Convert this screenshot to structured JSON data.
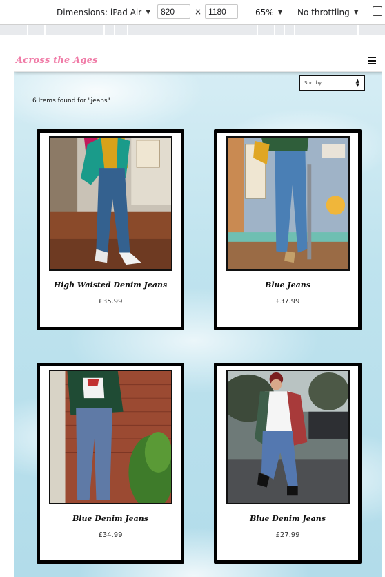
{
  "devtools": {
    "dimensions_label": "Dimensions: iPad Air",
    "width": "820",
    "times": "×",
    "height": "1180",
    "zoom": "65%",
    "throttling": "No throttling"
  },
  "site": {
    "brand": "Across the Ages",
    "sort_placeholder": "Sort by...",
    "result_count": "6 Items found for \"jeans\""
  },
  "products": [
    {
      "name": "High Waisted Denim Jeans",
      "price": "£35.99"
    },
    {
      "name": "Blue Jeans",
      "price": "£37.99"
    },
    {
      "name": "Blue Denim Jeans",
      "price": "£34.99"
    },
    {
      "name": "Blue Denim Jeans",
      "price": "£27.99"
    }
  ],
  "icons": {
    "dropdown": "caret-down-icon",
    "menu": "hamburger-menu-icon",
    "sort_arrows": "sort-arrows-icon",
    "rotate": "rotate-device-icon"
  },
  "colors": {
    "brand": "#f07aa6",
    "card_border": "#000000",
    "background_sky": "#bfe3ee"
  }
}
